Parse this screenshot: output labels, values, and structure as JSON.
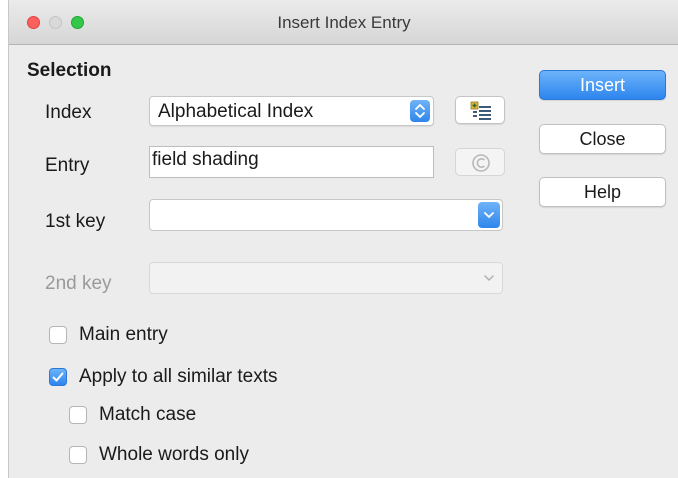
{
  "window": {
    "title": "Insert Index Entry"
  },
  "selection": {
    "heading": "Selection",
    "index": {
      "label": "Index",
      "value": "Alphabetical Index"
    },
    "entry": {
      "label": "Entry",
      "value": "field shading"
    },
    "key1": {
      "label": "1st key",
      "value": ""
    },
    "key2": {
      "label": "2nd key",
      "value": ""
    }
  },
  "options": {
    "main_entry": {
      "label": "Main entry",
      "checked": false
    },
    "apply_all": {
      "label": "Apply to all similar texts",
      "checked": true
    },
    "match_case": {
      "label": "Match case",
      "checked": false
    },
    "whole_words": {
      "label": "Whole words only",
      "checked": false
    }
  },
  "buttons": {
    "insert": "Insert",
    "close": "Close",
    "help": "Help"
  },
  "icons": {
    "new_index": "new-user-index-icon",
    "apply_phonetic": "update-entry-icon"
  },
  "colors": {
    "accent": "#2d85ee",
    "window_bg": "#ececec"
  }
}
